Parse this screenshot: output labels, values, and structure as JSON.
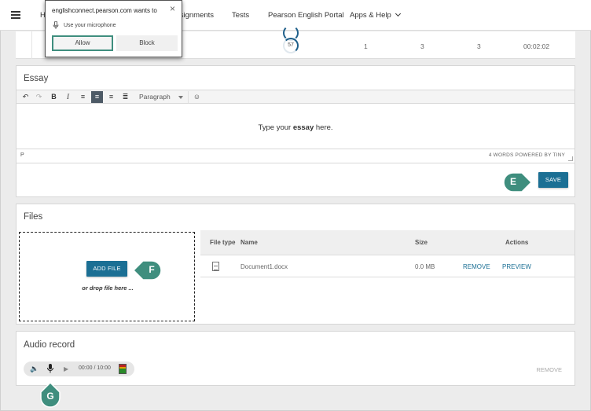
{
  "nav": {
    "items": [
      {
        "label": "H"
      },
      {
        "label": "ssignments"
      },
      {
        "label": "Tests"
      },
      {
        "label": "Pearson English Portal"
      },
      {
        "label": "Apps & Help"
      }
    ]
  },
  "score_row": {
    "ring_value": "57",
    "cells": [
      "1",
      "3",
      "3",
      "00:02:02"
    ]
  },
  "permission": {
    "title": "englishconnect.pearson.com wants to",
    "close": "×",
    "request": "Use your microphone",
    "allow": "Allow",
    "block": "Block"
  },
  "essay": {
    "title": "Essay",
    "block_format": "Paragraph",
    "placeholder_pre": "Type your ",
    "placeholder_bold": "essay",
    "placeholder_post": " here.",
    "status_element": "P",
    "word_count": "4 WORDS POWERED BY TINY",
    "save_label": "SAVE",
    "callout": "E"
  },
  "files": {
    "title": "Files",
    "add_label": "ADD FILE",
    "drop_text": "or drop file here ...",
    "callout": "F",
    "columns": [
      "File type",
      "Name",
      "Size",
      "Actions"
    ],
    "rows": [
      {
        "name": "Document1.docx",
        "size": "0.0 MB",
        "remove": "REMOVE",
        "preview": "PREVIEW"
      }
    ]
  },
  "audio": {
    "title": "Audio record",
    "time": "00:00 / 10:00",
    "remove": "REMOVE",
    "callout": "G"
  },
  "colors": {
    "primary": "#1b6f94",
    "callout": "#3f8e7e"
  }
}
